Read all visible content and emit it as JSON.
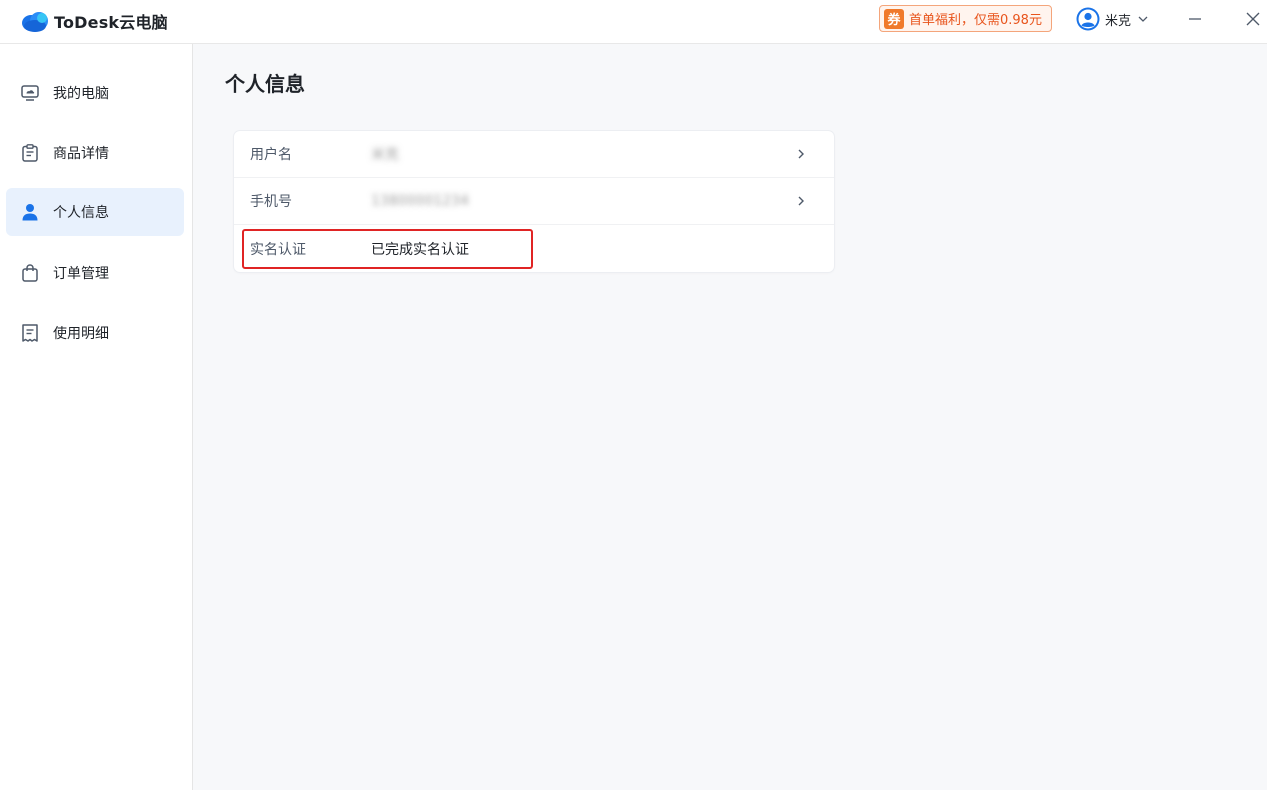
{
  "app": {
    "title": "ToDesk云电脑"
  },
  "header": {
    "promo_icon_text": "券",
    "promo_text": "首单福利，仅需0.98元",
    "user_name": "米克"
  },
  "sidebar": {
    "items": [
      {
        "label": "我的电脑",
        "icon": "monitor-icon",
        "active": false
      },
      {
        "label": "商品详情",
        "icon": "clipboard-icon",
        "active": false
      },
      {
        "label": "个人信息",
        "icon": "person-icon",
        "active": true
      },
      {
        "label": "订单管理",
        "icon": "shopping-bag-icon",
        "active": false
      },
      {
        "label": "使用明细",
        "icon": "receipt-icon",
        "active": false
      }
    ]
  },
  "main": {
    "page_title": "个人信息",
    "rows": [
      {
        "label": "用户名",
        "value": "米克",
        "blurred": true
      },
      {
        "label": "手机号",
        "value": "13800001234",
        "blurred": true
      },
      {
        "label": "实名认证",
        "value": "已完成实名认证",
        "blurred": false
      }
    ]
  },
  "colors": {
    "accent": "#1a73e8",
    "active_bg": "#e8f1fd",
    "promo": "#e8541c",
    "highlight": "#e02424",
    "content_bg": "#f7f8fa"
  }
}
